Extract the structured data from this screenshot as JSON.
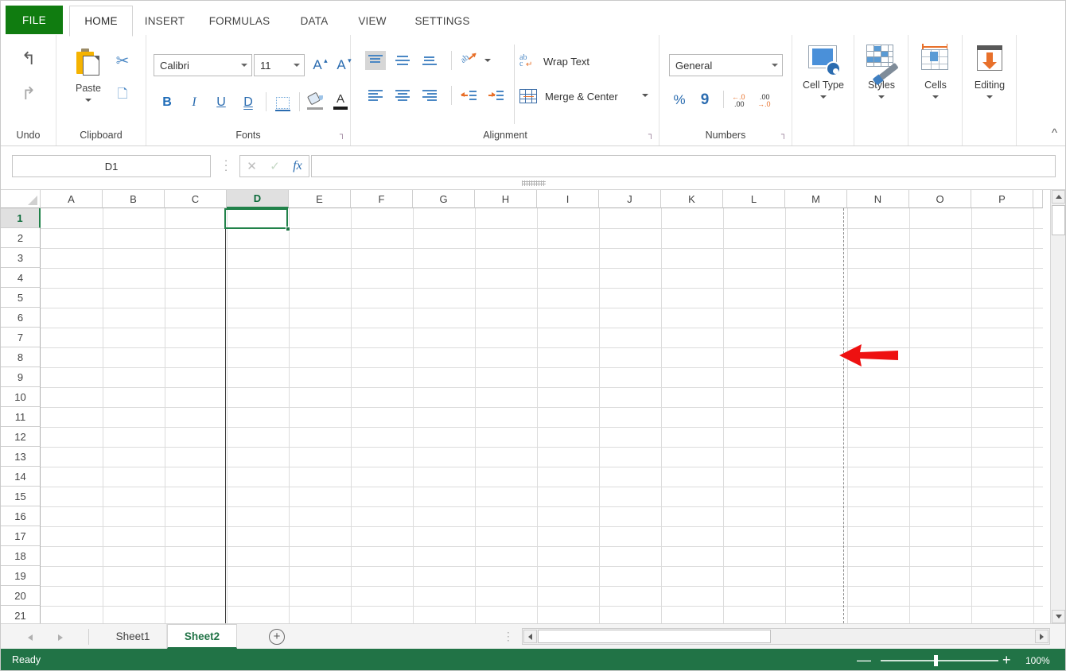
{
  "ribbon_tabs": [
    {
      "label": "FILE",
      "active": false,
      "file": true
    },
    {
      "label": "HOME",
      "active": true
    },
    {
      "label": "INSERT",
      "active": false
    },
    {
      "label": "FORMULAS",
      "active": false
    },
    {
      "label": "DATA",
      "active": false
    },
    {
      "label": "VIEW",
      "active": false
    },
    {
      "label": "SETTINGS",
      "active": false
    }
  ],
  "groups": {
    "undo": {
      "label": "Undo",
      "undo_icon": "undo-arrow-icon",
      "redo_icon": "redo-arrow-icon"
    },
    "clipboard": {
      "label": "Clipboard",
      "paste_label": "Paste",
      "cut_icon": "scissors-icon",
      "copy_icon": "copy-icon",
      "paste_icon": "clipboard-paste-icon"
    },
    "fonts": {
      "label": "Fonts",
      "font_name": "Calibri",
      "font_size": "11",
      "grow_icon": "increase-font-size-icon",
      "shrink_icon": "decrease-font-size-icon",
      "bold": "B",
      "italic": "I",
      "underline": "U",
      "double_underline": "D",
      "borders_icon": "borders-icon",
      "fill_icon": "fill-color-icon",
      "font_color_icon": "font-color-icon"
    },
    "alignment": {
      "label": "Alignment",
      "wrap_text": "Wrap Text",
      "merge_center": "Merge & Center",
      "top_align": "align-top-icon",
      "middle_align": "align-middle-icon",
      "bottom_align": "align-bottom-icon",
      "orientation": "text-orientation-icon",
      "align_left": "align-left-icon",
      "align_center": "align-center-icon",
      "align_right": "align-right-icon",
      "decrease_indent": "decrease-indent-icon",
      "increase_indent": "increase-indent-icon"
    },
    "numbers": {
      "label": "Numbers",
      "format": "General",
      "percent": "%",
      "comma": "9",
      "increase_decimal": "increase-decimal-icon",
      "decrease_decimal": "decrease-decimal-icon"
    },
    "cell_type": {
      "label": "Cell Type",
      "icon": "cell-type-icon"
    },
    "styles": {
      "label": "Styles",
      "icon": "styles-brush-icon"
    },
    "cells": {
      "label": "Cells",
      "icon": "cells-icon"
    },
    "editing": {
      "label": "Editing",
      "icon": "editing-fill-down-icon"
    },
    "collapse": "collapse-ribbon-chevron-icon"
  },
  "formula_bar": {
    "name_box_value": "D1",
    "name_box_placeholder": "",
    "cancel_icon": "cancel-x-icon",
    "confirm_icon": "confirm-check-icon",
    "function_icon": "insert-function-fx-icon",
    "formula_value": "",
    "formula_placeholder": "",
    "resize_grip": "formula-bar-resize-grip"
  },
  "grid": {
    "columns": [
      "A",
      "B",
      "C",
      "D",
      "E",
      "F",
      "G",
      "H",
      "I",
      "J",
      "K",
      "L",
      "M",
      "N",
      "O",
      "P"
    ],
    "rows": [
      "1",
      "2",
      "3",
      "4",
      "5",
      "6",
      "7",
      "8",
      "9",
      "10",
      "11",
      "12",
      "13",
      "14",
      "15",
      "16",
      "17",
      "18",
      "19",
      "20",
      "21"
    ],
    "active_cell": "D1",
    "active_column": "D",
    "active_row": "1",
    "freeze_pane_column": "D",
    "page_break_column": "N",
    "annotation_arrow": "red-left-pointing-arrow",
    "annotation_color": "#ee1111"
  },
  "sheet_tabs": {
    "prev_icon": "previous-sheet-icon",
    "next_icon": "next-sheet-icon",
    "sheets": [
      {
        "label": "Sheet1",
        "active": false
      },
      {
        "label": "Sheet2",
        "active": true
      }
    ],
    "add_sheet_icon": "add-sheet-plus-icon",
    "add_sheet_glyph": "+",
    "split_handle": "horizontal-split-handle"
  },
  "status_bar": {
    "status": "Ready",
    "zoom_out_glyph": "—",
    "zoom_in_glyph": "+",
    "zoom_level": "100%"
  },
  "colors": {
    "file_green": "#107C10",
    "status_green": "#217346",
    "accent_blue": "#2B6CB0",
    "accent_orange": "#E8702A",
    "arrow_red": "#ee1111"
  }
}
